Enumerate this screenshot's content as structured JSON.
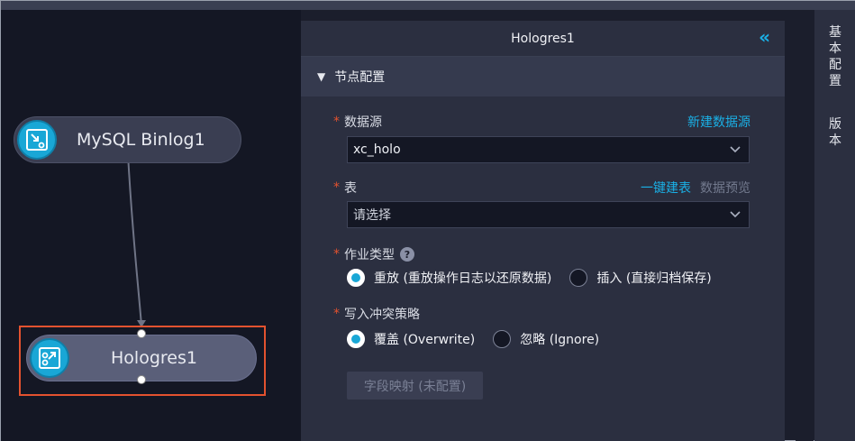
{
  "canvas": {
    "nodes": [
      {
        "label": "MySQL Binlog1",
        "icon": "mysql-binlog-icon"
      },
      {
        "label": "Hologres1",
        "icon": "hologres-icon"
      }
    ]
  },
  "panel": {
    "title": "Hologres1",
    "collapse_icon": "double-chevron-left-icon",
    "section_title": "节点配置",
    "datasource": {
      "required": "*",
      "label": "数据源",
      "link": "新建数据源",
      "value": "xc_holo"
    },
    "table": {
      "required": "*",
      "label": "表",
      "link_primary": "一键建表",
      "link_secondary": "数据预览",
      "placeholder": "请选择"
    },
    "job_type": {
      "required": "*",
      "label": "作业类型",
      "help": "?",
      "options": [
        {
          "label": "重放 (重放操作日志以还原数据)",
          "selected": true
        },
        {
          "label": "插入 (直接归档保存)",
          "selected": false
        }
      ]
    },
    "conflict": {
      "required": "*",
      "label": "写入冲突策略",
      "options": [
        {
          "label": "覆盖 (Overwrite)",
          "selected": true
        },
        {
          "label": "忽略 (Ignore)",
          "selected": false
        }
      ]
    },
    "mapping_button": "字段映射 (未配置)"
  },
  "sidebar": {
    "tab1": [
      "基",
      "本",
      "配",
      "置"
    ],
    "tab2": [
      "版",
      "本"
    ]
  },
  "colors": {
    "accent": "#1ab0e6",
    "required": "#e3522f",
    "selection": "#e3522f"
  }
}
